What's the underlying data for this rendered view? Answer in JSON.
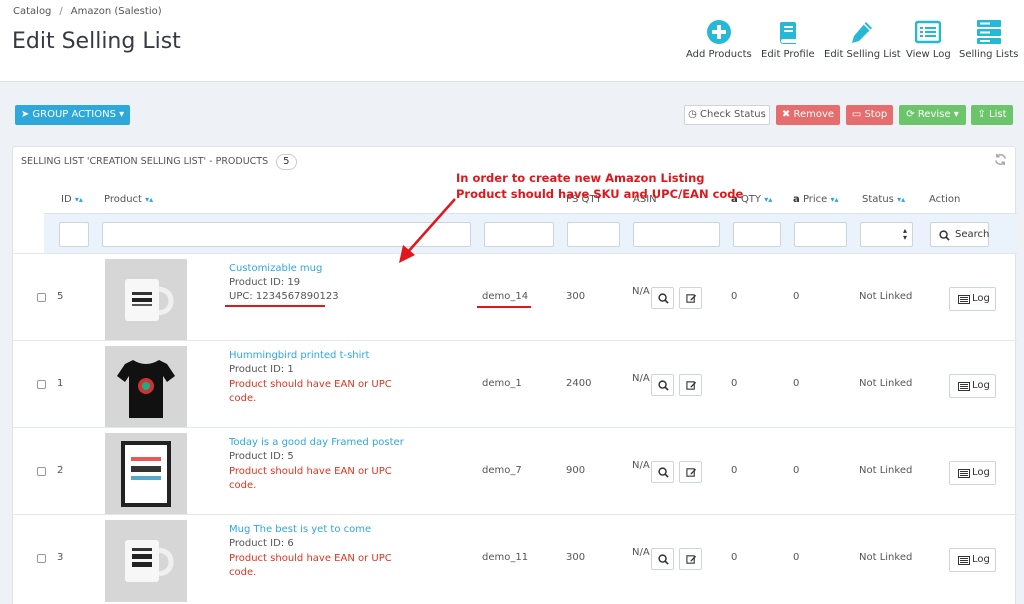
{
  "breadcrumb": {
    "catalog": "Catalog",
    "sep": "/",
    "current": "Amazon (Salestio)"
  },
  "page_title": "Edit Selling List",
  "toolbar": {
    "add_products": "Add Products",
    "edit_profile": "Edit Profile",
    "edit_selling_list": "Edit Selling List",
    "view_log": "View Log",
    "selling_lists": "Selling Lists"
  },
  "actions": {
    "group_actions": "GROUP ACTIONS",
    "check_status": "Check Status",
    "remove": "Remove",
    "stop": "Stop",
    "revise": "Revise",
    "list": "List"
  },
  "panel": {
    "title": "SELLING LIST 'CREATION SELLING LIST' - PRODUCTS",
    "count": "5"
  },
  "columns": {
    "id": "ID",
    "product": "Product",
    "sku": "SKU",
    "ps_qty": "PS QTY",
    "asin": "ASIN",
    "qty": "QTY",
    "price": "Price",
    "status": "Status",
    "action": "Action"
  },
  "search_label": "Search",
  "log_label": "Log",
  "rows": [
    {
      "id": "5",
      "name": "Customizable mug",
      "product_id": "Product ID: 19",
      "upc": "UPC: 1234567890123",
      "error_line1": "",
      "error_line2": "",
      "sku": "demo_14",
      "ps_qty": "300",
      "asin": "N/A",
      "qty": "0",
      "price": "0",
      "status": "Not Linked",
      "thumb": "mug-image"
    },
    {
      "id": "1",
      "name": "Hummingbird printed t-shirt",
      "product_id": "Product ID: 1",
      "upc": "",
      "error_line1": "Product should have EAN or UPC",
      "error_line2": "code.",
      "sku": "demo_1",
      "ps_qty": "2400",
      "asin": "N/A",
      "qty": "0",
      "price": "0",
      "status": "Not Linked",
      "thumb": "tshirt-image"
    },
    {
      "id": "2",
      "name": "Today is a good day Framed poster",
      "product_id": "Product ID: 5",
      "upc": "",
      "error_line1": "Product should have EAN or UPC",
      "error_line2": "code.",
      "sku": "demo_7",
      "ps_qty": "900",
      "asin": "N/A",
      "qty": "0",
      "price": "0",
      "status": "Not Linked",
      "thumb": "poster-image"
    },
    {
      "id": "3",
      "name": "Mug The best is yet to come",
      "product_id": "Product ID: 6",
      "upc": "",
      "error_line1": "Product should have EAN or UPC",
      "error_line2": "code.",
      "sku": "demo_11",
      "ps_qty": "300",
      "asin": "N/A",
      "qty": "0",
      "price": "0",
      "status": "Not Linked",
      "thumb": "mug-image"
    }
  ],
  "annotation": {
    "line1": "In order to create new Amazon Listing",
    "line2": "Product should have SKU and UPC/EAN code"
  },
  "colors": {
    "accent": "#2ea8db",
    "danger": "#e66d6d",
    "success": "#6dc56b",
    "annotation": "#e0171c"
  }
}
